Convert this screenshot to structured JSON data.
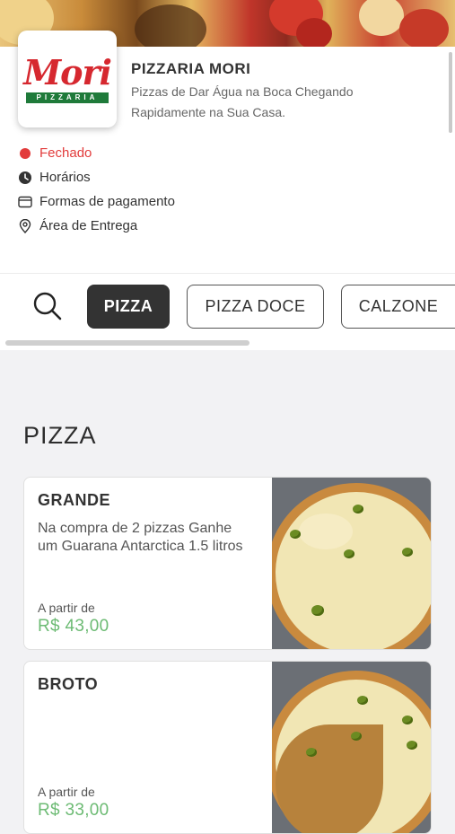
{
  "store": {
    "name": "PIZZARIA MORI",
    "description": "Pizzas de Dar Água na Boca Chegando Rapidamente na Sua Casa.",
    "logo_word": "Mori",
    "logo_band": "PIZZARIA"
  },
  "info": {
    "status": "Fechado",
    "hours": "Horários",
    "payment": "Formas de pagamento",
    "delivery_area": "Área de Entrega"
  },
  "categories": [
    {
      "label": "PIZZA",
      "active": true
    },
    {
      "label": "PIZZA DOCE",
      "active": false
    },
    {
      "label": "CALZONE",
      "active": false
    }
  ],
  "section": {
    "title": "PIZZA"
  },
  "products": [
    {
      "title": "GRANDE",
      "description": "Na compra de 2 pizzas Ganhe um Guarana Antarctica 1.5 litros",
      "from_label": "A partir de",
      "price": "R$ 43,00"
    },
    {
      "title": "BROTO",
      "description": "",
      "from_label": "A partir de",
      "price": "R$ 33,00"
    }
  ],
  "colors": {
    "status_closed": "#e23b3b",
    "price": "#6dbb74",
    "chip_active": "#333333",
    "logo_red": "#d6282f",
    "logo_green": "#1f7a3a"
  }
}
